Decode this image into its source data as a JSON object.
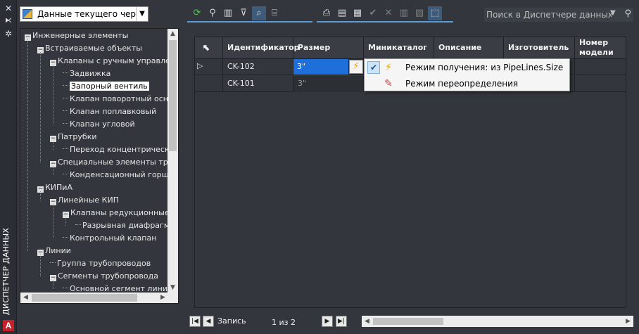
{
  "palette": {
    "title": "ДИСПЕТЧЕР ДАННЫХ",
    "logo_letter": "A"
  },
  "view_selector": {
    "selected": "Данные текущего чертежа"
  },
  "search": {
    "placeholder": "Поиск в Диспетчере данных"
  },
  "tree": {
    "items": [
      {
        "label": "Инженерные элементы",
        "level": 0,
        "expander": "minus"
      },
      {
        "label": "Встраиваемые объекты",
        "level": 1,
        "expander": "minus"
      },
      {
        "label": "Клапаны с ручным управлением",
        "level": 2,
        "expander": "minus"
      },
      {
        "label": "Задвижка",
        "level": 3
      },
      {
        "label": "Запорный вентиль",
        "level": 3,
        "selected": true
      },
      {
        "label": "Клапан поворотный основной",
        "level": 3
      },
      {
        "label": "Клапан поплавковый",
        "level": 3
      },
      {
        "label": "Клапан угловой",
        "level": 3
      },
      {
        "label": "Патрубки",
        "level": 2,
        "expander": "minus"
      },
      {
        "label": "Переход концентрический",
        "level": 3
      },
      {
        "label": "Специальные элементы трубопровода",
        "level": 2,
        "expander": "minus"
      },
      {
        "label": "Конденсационный горшок",
        "level": 3
      },
      {
        "label": "КИПиА",
        "level": 1,
        "expander": "minus"
      },
      {
        "label": "Линейные КИП",
        "level": 2,
        "expander": "minus"
      },
      {
        "label": "Клапаны редукционные",
        "level": 3,
        "expander": "minus"
      },
      {
        "label": "Разрывная диафрагма",
        "level": 4
      },
      {
        "label": "Контрольный клапан",
        "level": 3
      },
      {
        "label": "Линии",
        "level": 1,
        "expander": "minus"
      },
      {
        "label": "Группа трубопроводов",
        "level": 2
      },
      {
        "label": "Сегменты трубопровода",
        "level": 2,
        "expander": "minus"
      },
      {
        "label": "Основной сегмент линии",
        "level": 3
      }
    ]
  },
  "grid": {
    "columns": [
      "Идентификатор",
      "Размер",
      "Миникаталог",
      "Описание",
      "Изготовитель",
      "Номер модели"
    ],
    "rows": [
      {
        "id": "CK-102",
        "size": "3\""
      },
      {
        "id": "CK-101",
        "size": "3\""
      }
    ]
  },
  "size_menu": {
    "items": [
      {
        "label": "Режим получения: из PipeLines.Size",
        "icon": "lightning-icon",
        "checked": true
      },
      {
        "label": "Режим переопределения",
        "icon": "pencil-icon",
        "checked": false
      }
    ]
  },
  "navigator": {
    "record_label": "Запись",
    "position": "1",
    "of_label": "из",
    "total": "2"
  },
  "colors": {
    "accent": "#5b9bd5",
    "selection": "#1e6fd9",
    "background": "#33373d"
  }
}
